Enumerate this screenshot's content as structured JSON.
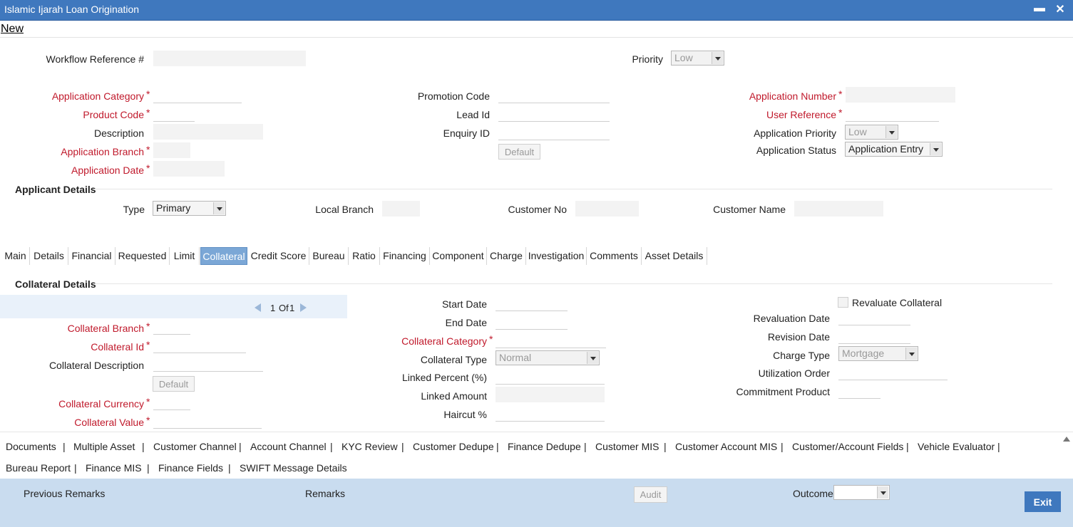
{
  "window": {
    "title": "Islamic Ijarah Loan Origination",
    "minimize": "▬",
    "close": "✕"
  },
  "menu": {
    "new": "New"
  },
  "header": {
    "workflow_ref_label": "Workflow Reference #",
    "priority_label": "Priority",
    "priority_value": "Low",
    "app_category_label": "Application Category",
    "product_code_label": "Product Code",
    "description_label": "Description",
    "app_branch_label": "Application Branch",
    "app_date_label": "Application Date",
    "promotion_code_label": "Promotion Code",
    "lead_id_label": "Lead Id",
    "enquiry_id_label": "Enquiry ID",
    "default_label": "Default",
    "app_number_label": "Application Number",
    "user_ref_label": "User Reference",
    "app_priority_label": "Application Priority",
    "app_priority_value": "Low",
    "app_status_label": "Application Status",
    "app_status_value": "Application Entry",
    "required_mark": "*"
  },
  "applicant": {
    "title": "Applicant Details",
    "type_label": "Type",
    "type_value": "Primary",
    "local_branch_label": "Local Branch",
    "customer_no_label": "Customer No",
    "customer_name_label": "Customer Name"
  },
  "tabs": [
    "Main",
    "Details",
    "Financial",
    "Requested",
    "Limit",
    "Collateral",
    "Credit Score",
    "Bureau",
    "Ratio",
    "Financing",
    "Component",
    "Charge",
    "Investigation",
    "Comments",
    "Asset Details"
  ],
  "active_tab": "Collateral",
  "collateral": {
    "title": "Collateral Details",
    "pager_current": "1",
    "pager_of": "Of",
    "pager_total": "1",
    "branch_label": "Collateral Branch",
    "id_label": "Collateral Id",
    "desc_label": "Collateral Description",
    "default_label": "Default",
    "currency_label": "Collateral Currency",
    "value_label": "Collateral Value",
    "start_date_label": "Start Date",
    "end_date_label": "End Date",
    "category_label": "Collateral Category",
    "type_label": "Collateral Type",
    "type_value": "Normal",
    "linked_pct_label": "Linked Percent (%)",
    "linked_amt_label": "Linked Amount",
    "haircut_label": "Haircut %",
    "revaluate_label": "Revaluate Collateral",
    "revaluation_date_label": "Revaluation Date",
    "revision_date_label": "Revision Date",
    "charge_type_label": "Charge Type",
    "charge_type_value": "Mortgage",
    "utilization_label": "Utilization Order",
    "commitment_label": "Commitment Product"
  },
  "links_row1": [
    "Documents",
    "Multiple Asset",
    "Customer Channel",
    "Account Channel",
    "KYC Review",
    "Customer Dedupe",
    "Finance Dedupe",
    "Customer MIS",
    "Customer Account MIS",
    "Customer/Account Fields",
    "Vehicle Evaluator"
  ],
  "links_row2": [
    "Bureau Report",
    "Finance MIS",
    "Finance Fields",
    "SWIFT Message Details"
  ],
  "footer": {
    "prev_remarks": "Previous Remarks",
    "remarks": "Remarks",
    "audit": "Audit",
    "outcome": "Outcome",
    "exit": "Exit"
  },
  "colors": {
    "titlebar": "#3f78be",
    "required": "#c0192b",
    "active_tab": "#7ba7d6",
    "footer": "#c9dcef"
  }
}
